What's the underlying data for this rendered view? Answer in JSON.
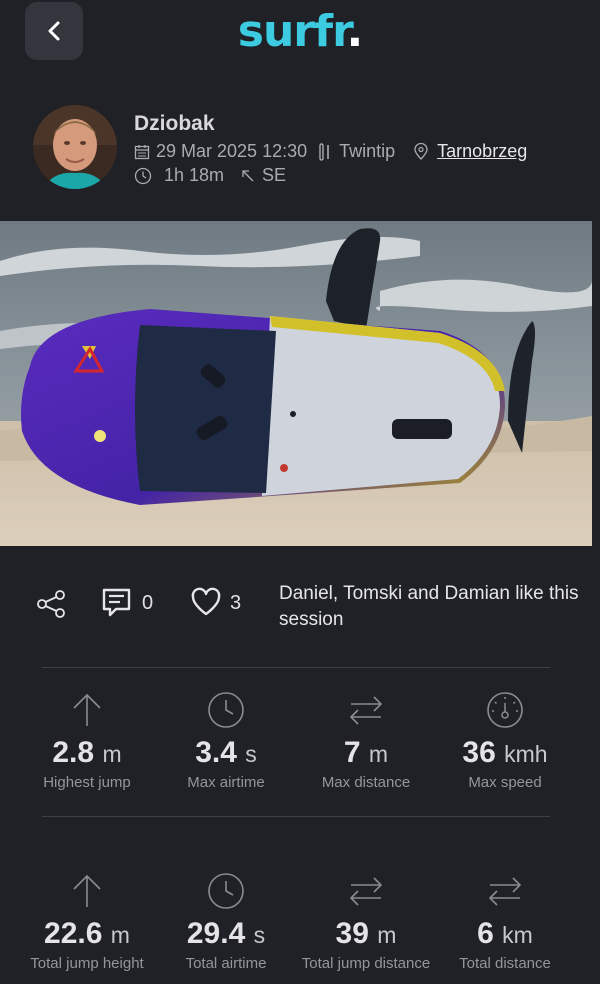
{
  "header": {
    "logo_main": "surfr",
    "logo_dot": ".",
    "back_icon": "chevron-left-icon"
  },
  "profile": {
    "name": "Dziobak",
    "date": "29 Mar 2025 12:30",
    "sport": "Twintip",
    "location": "Tarnobrzeg",
    "duration": "1h 18m",
    "wind_direction": "SE"
  },
  "social": {
    "comments": "0",
    "likes": "3",
    "likes_text": "Daniel, Tomski and Damian like this session"
  },
  "stats_top": [
    {
      "icon": "arrow-up-icon",
      "value": "2.8",
      "unit": "m",
      "label": "Highest jump"
    },
    {
      "icon": "clock-icon",
      "value": "3.4",
      "unit": "s",
      "label": "Max airtime"
    },
    {
      "icon": "arrows-swap-icon",
      "value": "7",
      "unit": "m",
      "label": "Max distance"
    },
    {
      "icon": "speedometer-icon",
      "value": "36",
      "unit": "kmh",
      "label": "Max speed"
    }
  ],
  "stats_bottom": [
    {
      "icon": "arrow-up-icon",
      "value": "22.6",
      "unit": "m",
      "label": "Total jump height"
    },
    {
      "icon": "clock-icon",
      "value": "29.4",
      "unit": "s",
      "label": "Total airtime"
    },
    {
      "icon": "arrows-swap-icon",
      "value": "39",
      "unit": "m",
      "label": "Total jump distance"
    },
    {
      "icon": "arrows-swap-icon",
      "value": "6",
      "unit": "km",
      "label": "Total distance"
    }
  ]
}
